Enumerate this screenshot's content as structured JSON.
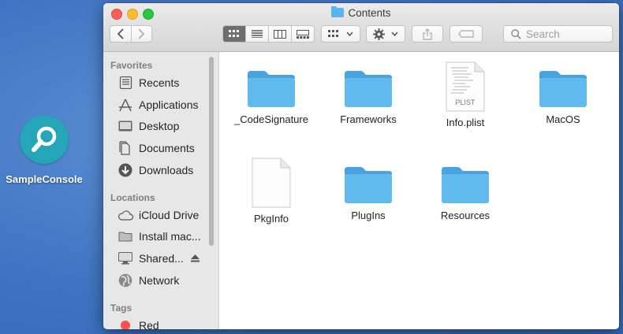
{
  "desktop": {
    "icon_label": "SampleConsole"
  },
  "window": {
    "title": "Contents",
    "search_placeholder": "Search"
  },
  "sidebar": {
    "favorites_header": "Favorites",
    "favorites": [
      {
        "label": "Recents",
        "icon": "recents-icon"
      },
      {
        "label": "Applications",
        "icon": "applications-icon"
      },
      {
        "label": "Desktop",
        "icon": "desktop-icon"
      },
      {
        "label": "Documents",
        "icon": "documents-icon"
      },
      {
        "label": "Downloads",
        "icon": "downloads-icon"
      }
    ],
    "locations_header": "Locations",
    "locations": [
      {
        "label": "iCloud Drive",
        "icon": "cloud-icon"
      },
      {
        "label": "Install mac...",
        "icon": "drive-icon"
      },
      {
        "label": "Shared...",
        "icon": "display-icon"
      },
      {
        "label": "Network",
        "icon": "globe-icon"
      }
    ],
    "tags_header": "Tags",
    "tags": [
      {
        "label": "Red",
        "color": "#fc4f4f"
      }
    ]
  },
  "files": [
    {
      "name": "_CodeSignature",
      "kind": "folder"
    },
    {
      "name": "Frameworks",
      "kind": "folder"
    },
    {
      "name": "Info.plist",
      "kind": "plist",
      "badge": "PLIST"
    },
    {
      "name": "MacOS",
      "kind": "folder"
    },
    {
      "name": "PkgInfo",
      "kind": "document"
    },
    {
      "name": "PlugIns",
      "kind": "folder"
    },
    {
      "name": "Resources",
      "kind": "folder"
    }
  ],
  "colors": {
    "folder": "#5cb4ea",
    "folder_dark": "#4aa3dc",
    "desktop_icon": "#25a6b8"
  }
}
